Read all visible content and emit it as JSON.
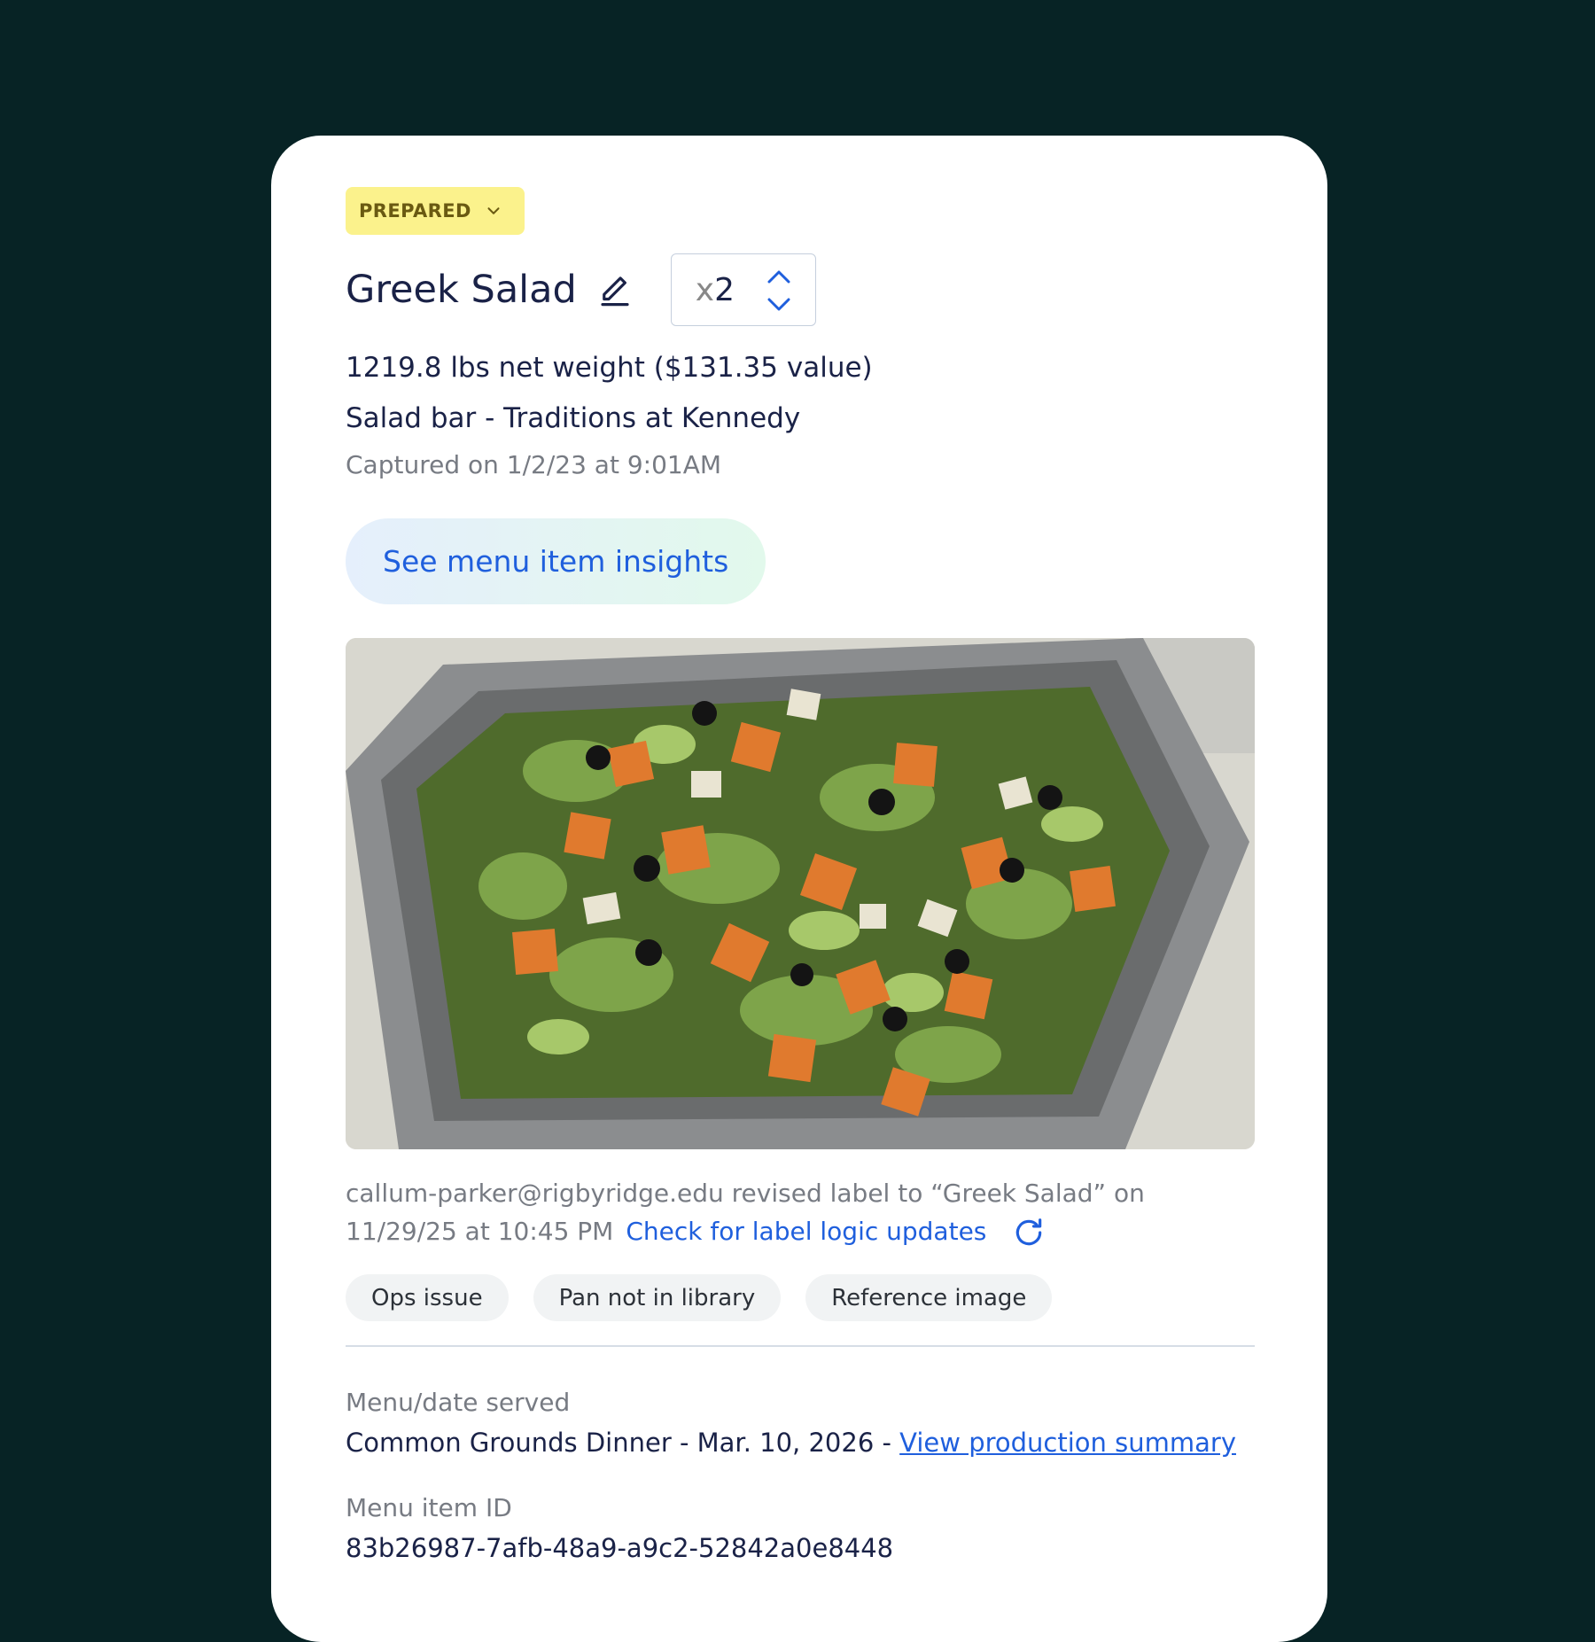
{
  "status": {
    "label": "PREPARED",
    "color": "#fbf28c"
  },
  "item": {
    "title": "Greek Salad",
    "qty_prefix": "x",
    "qty_value": "2",
    "weight_text": "1219.8 lbs net weight ($131.35 value)",
    "location": "Salad bar - Traditions at Kennedy",
    "captured": "Captured on 1/2/23 at 9:01AM"
  },
  "insights_button": {
    "label": "See menu item insights"
  },
  "photo": {
    "icon": "salad-pan-photo"
  },
  "revision": {
    "text": "callum-parker@rigbyridge.edu revised label to “Greek Salad” on 11/29/25 at 10:45 PM",
    "check_link": "Check for label logic updates"
  },
  "tags": [
    "Ops issue",
    "Pan not in library",
    "Reference image"
  ],
  "menu": {
    "label": "Menu/date served",
    "value_prefix": "Common Grounds Dinner - Mar. 10, 2026 - ",
    "link": "View production summary"
  },
  "menu_item_id": {
    "label": "Menu item ID",
    "value": "83b26987-7afb-48a9-a9c2-52842a0e8448"
  },
  "colors": {
    "background": "#072325",
    "accent": "#1f5fdd",
    "text": "#1a2247",
    "muted": "#777b83"
  }
}
